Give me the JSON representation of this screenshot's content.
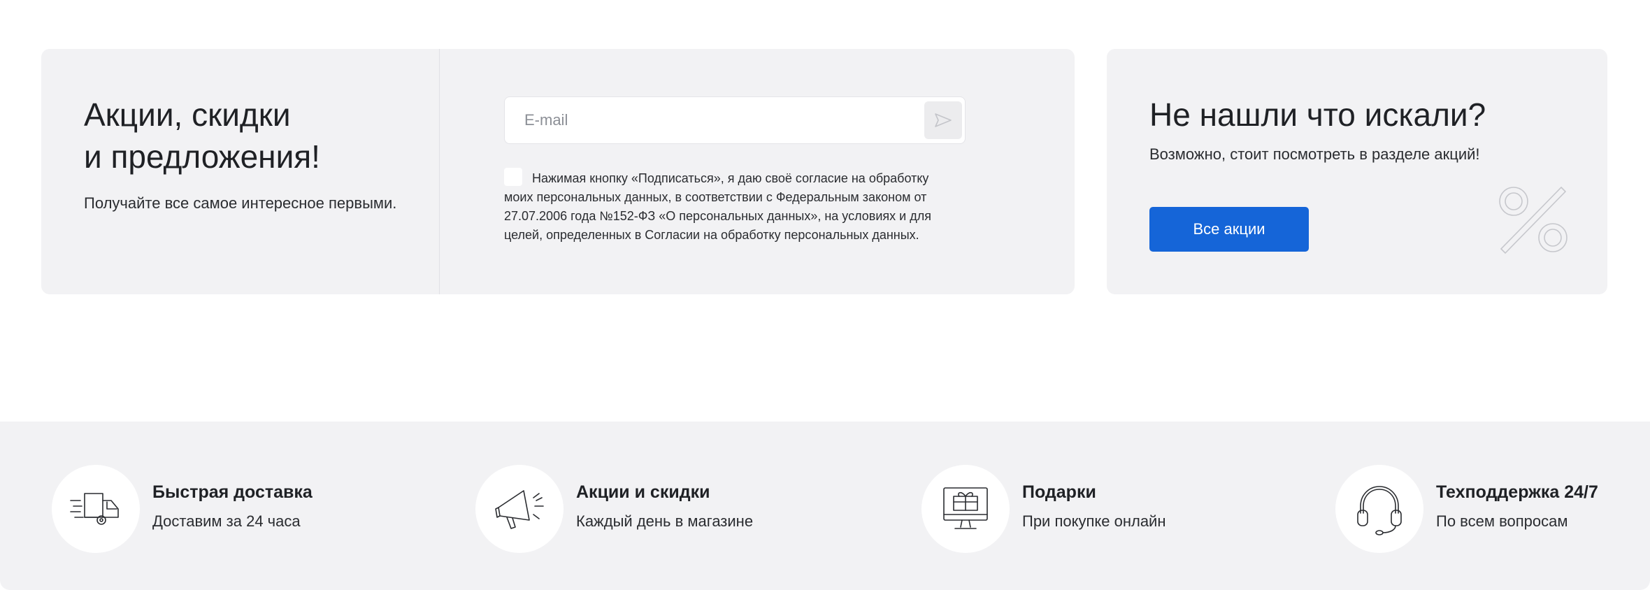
{
  "subscribe": {
    "title_line1": "Акции, скидки",
    "title_line2": "и предложения!",
    "subtitle": "Получайте все самое интересное первыми.",
    "email_placeholder": "E-mail",
    "send_icon": "send-arrow-icon",
    "consent_checked": false,
    "consent_text": "Нажимая кнопку «Подписаться», я даю своё согласие на обработку моих персональных данных, в соответствии с Федеральным законом от 27.07.2006 года №152-ФЗ «О персональных данных», на условиях и для целей, определенных в Согласии на обработку персональных данных."
  },
  "promo": {
    "title": "Не нашли что искали?",
    "text": "Возможно, стоит посмотреть в разделе акций!",
    "button_label": "Все акции",
    "button_color": "#1565d8",
    "decor_icon": "percent-icon"
  },
  "features": [
    {
      "icon": "delivery-truck-icon",
      "title": "Быстрая доставка",
      "subtitle": "Доставим за 24 часа"
    },
    {
      "icon": "megaphone-icon",
      "title": "Акции и скидки",
      "subtitle": "Каждый день в магазине"
    },
    {
      "icon": "gift-monitor-icon",
      "title": "Подарки",
      "subtitle": "При покупке онлайн"
    },
    {
      "icon": "headset-icon",
      "title": "Техподдержка 24/7",
      "subtitle": "По всем вопросам"
    }
  ]
}
